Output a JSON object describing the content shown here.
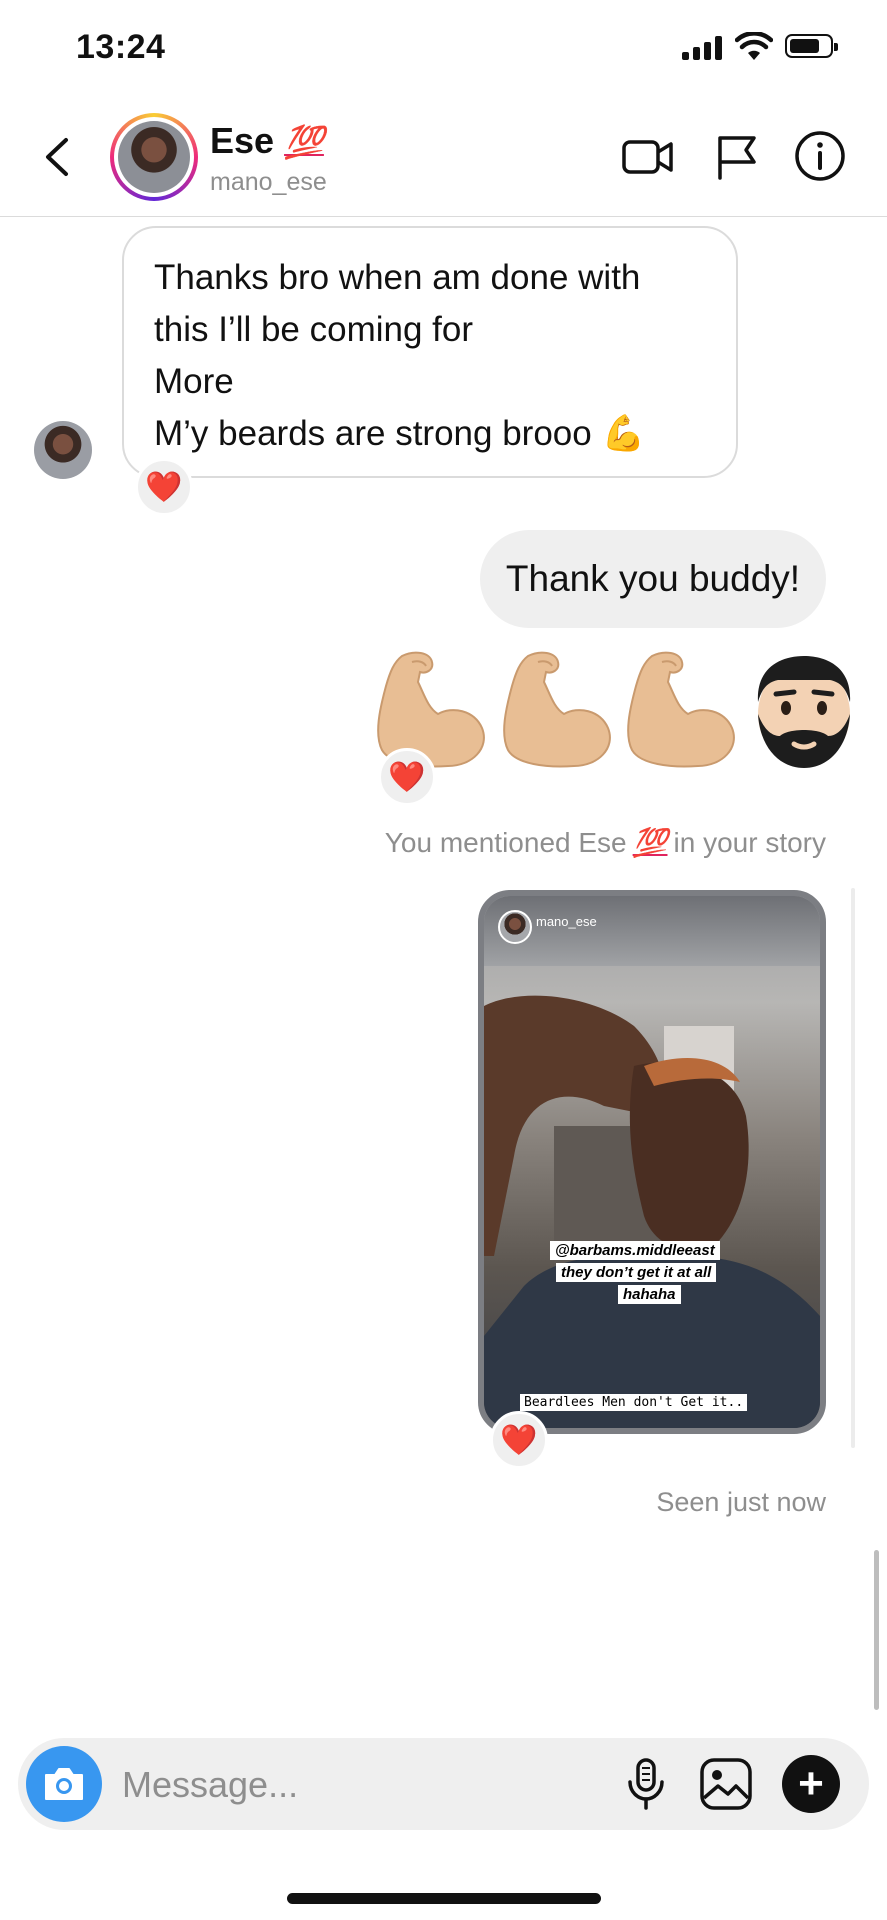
{
  "status_bar": {
    "time": "13:24",
    "icons": [
      "signal-icon",
      "wifi-icon",
      "battery-icon"
    ],
    "battery_level": 0.8
  },
  "header": {
    "back_icon": "chevron-left-icon",
    "name": "Ese",
    "name_emoji": "💯",
    "username": "mano_ese",
    "actions": [
      "video-call-icon",
      "flag-icon",
      "info-icon"
    ]
  },
  "messages": {
    "incoming": {
      "lines": [
        "Thanks bro when am done with",
        "this I’ll be coming for",
        "More",
        "M’y beards are strong brooo 💪"
      ],
      "reaction": "❤️"
    },
    "outgoing_text": "Thank you buddy!",
    "emoji_message": {
      "emojis": [
        "flexed-biceps",
        "flexed-biceps",
        "flexed-biceps",
        "bearded-man"
      ],
      "reaction": "❤️"
    },
    "story_mention": {
      "prefix": "You mentioned Ese",
      "emoji": "💯",
      "suffix": "in your story"
    },
    "story": {
      "username": "mano_ese",
      "tag_line1": "@barbams.middleeast",
      "tag_line2": "they don’t get it at all",
      "tag_line3": "hahaha",
      "caption": "Beardlees Men don't Get it..",
      "reaction": "❤️"
    },
    "seen": "Seen just now"
  },
  "composer": {
    "placeholder": "Message...",
    "value": "",
    "camera_icon": "camera-icon",
    "actions": [
      "microphone-icon",
      "gallery-icon",
      "plus-icon"
    ],
    "accent": "#3897f0"
  },
  "colors": {
    "bubble_incoming_border": "#dbdbdb",
    "bubble_outgoing": "#efefef",
    "secondary_text": "#8e8e8e",
    "heart": "#ed1c24"
  }
}
